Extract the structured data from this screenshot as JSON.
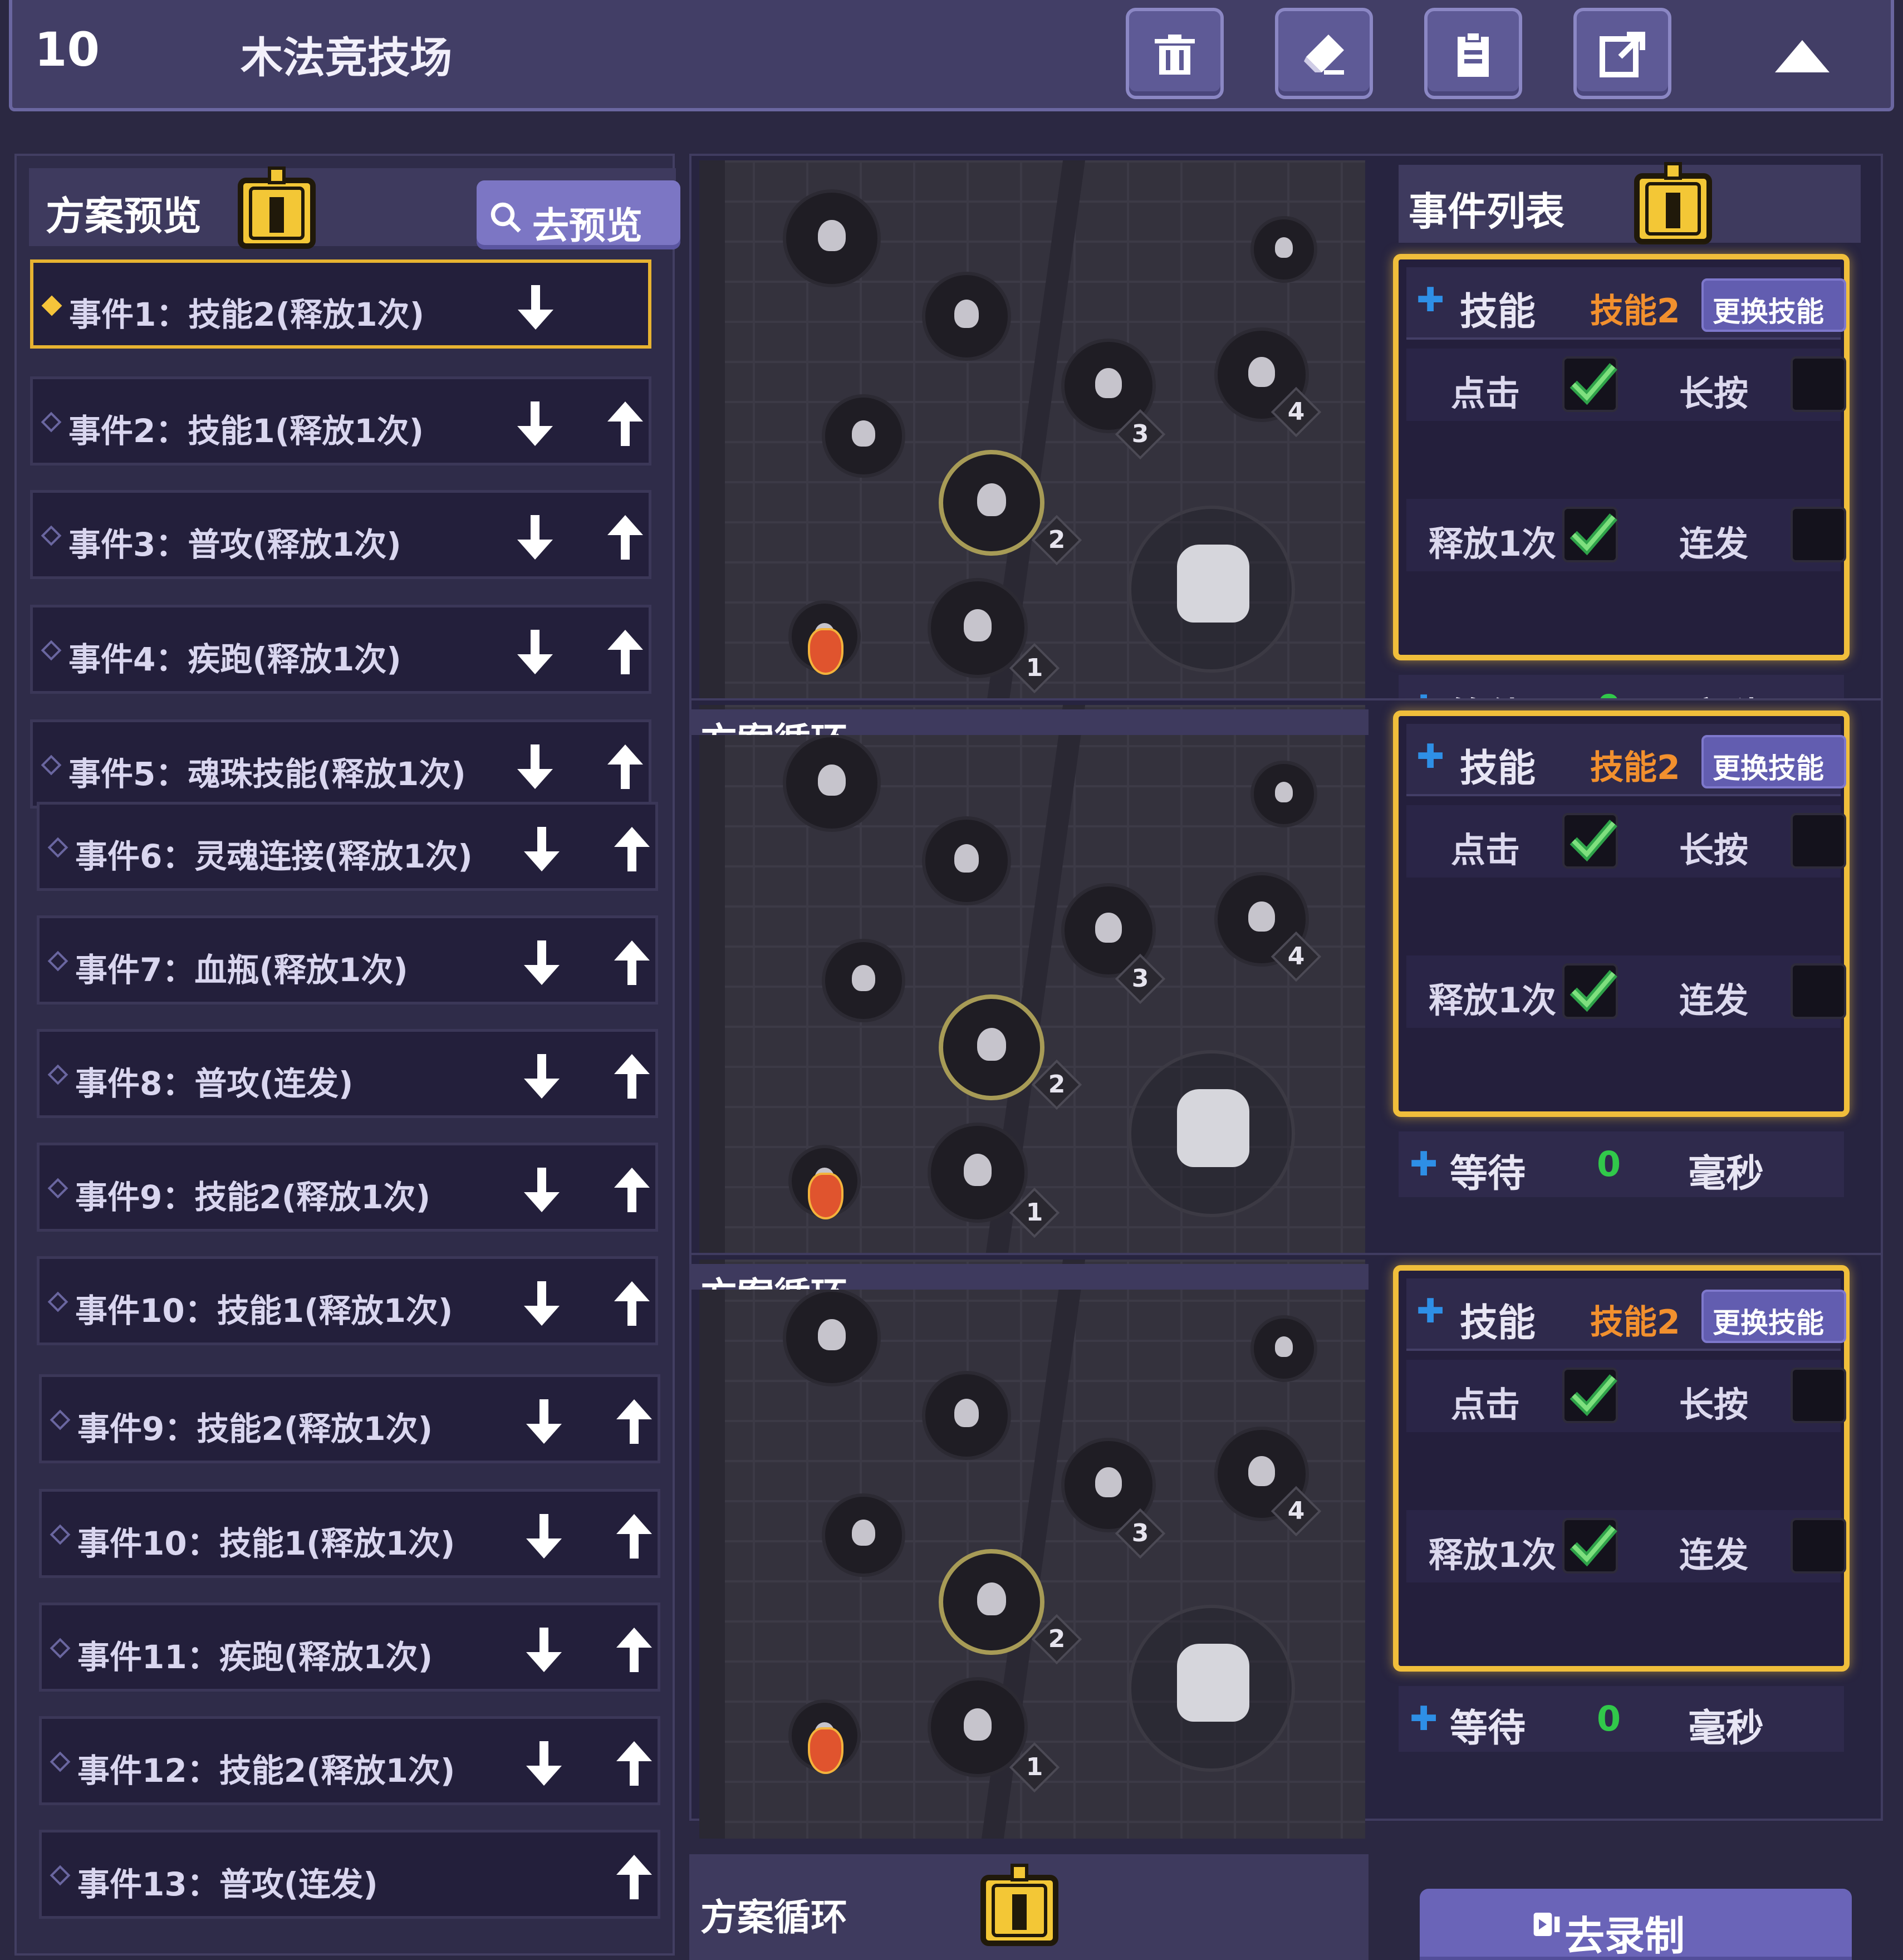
{
  "header": {
    "level": "10",
    "title": "木法竞技场",
    "tools": [
      "trash-icon",
      "eraser-icon",
      "clipboard-icon",
      "share-icon"
    ],
    "collapse_icon": "triangle-up-icon"
  },
  "plan_preview": {
    "title": "方案预览",
    "preview_button": "去预览",
    "events": [
      "事件1：技能2(释放1次)",
      "事件2：技能1(释放1次)",
      "事件3：普攻(释放1次)",
      "事件4：疾跑(释放1次)",
      "事件5：魂珠技能(释放1次)",
      "事件6：灵魂连接(释放1次)",
      "事件7：血瓶(释放1次)",
      "事件8：普攻(连发)",
      "事件9：技能2(释放1次)",
      "事件10：技能1(释放1次)",
      "事件9：技能2(释放1次)",
      "事件10：技能1(释放1次)",
      "事件11：疾跑(释放1次)",
      "事件12：技能2(释放1次)",
      "事件13：普攻(连发)"
    ]
  },
  "event_list": {
    "title": "事件列表",
    "skill_label": "技能",
    "skill_value": "技能2",
    "change_button": "更换技能",
    "click_label": "点击",
    "hold_label": "长按",
    "once_label": "释放1次",
    "rapid_label": "连发",
    "wait_label": "等待",
    "wait_value": "0",
    "wait_unit": "毫秒"
  },
  "map": {
    "badges": [
      "1",
      "2",
      "3",
      "4"
    ]
  },
  "plan_loop": {
    "title": "方案循环",
    "title_partial": "方案循环"
  },
  "record_button": "去录制",
  "colors": {
    "accent_gold": "#f0be3b",
    "button_purple": "#7c76c4",
    "check_green": "#31c84a",
    "skill_orange": "#f2902e",
    "plus_blue": "#2e8fe6"
  }
}
